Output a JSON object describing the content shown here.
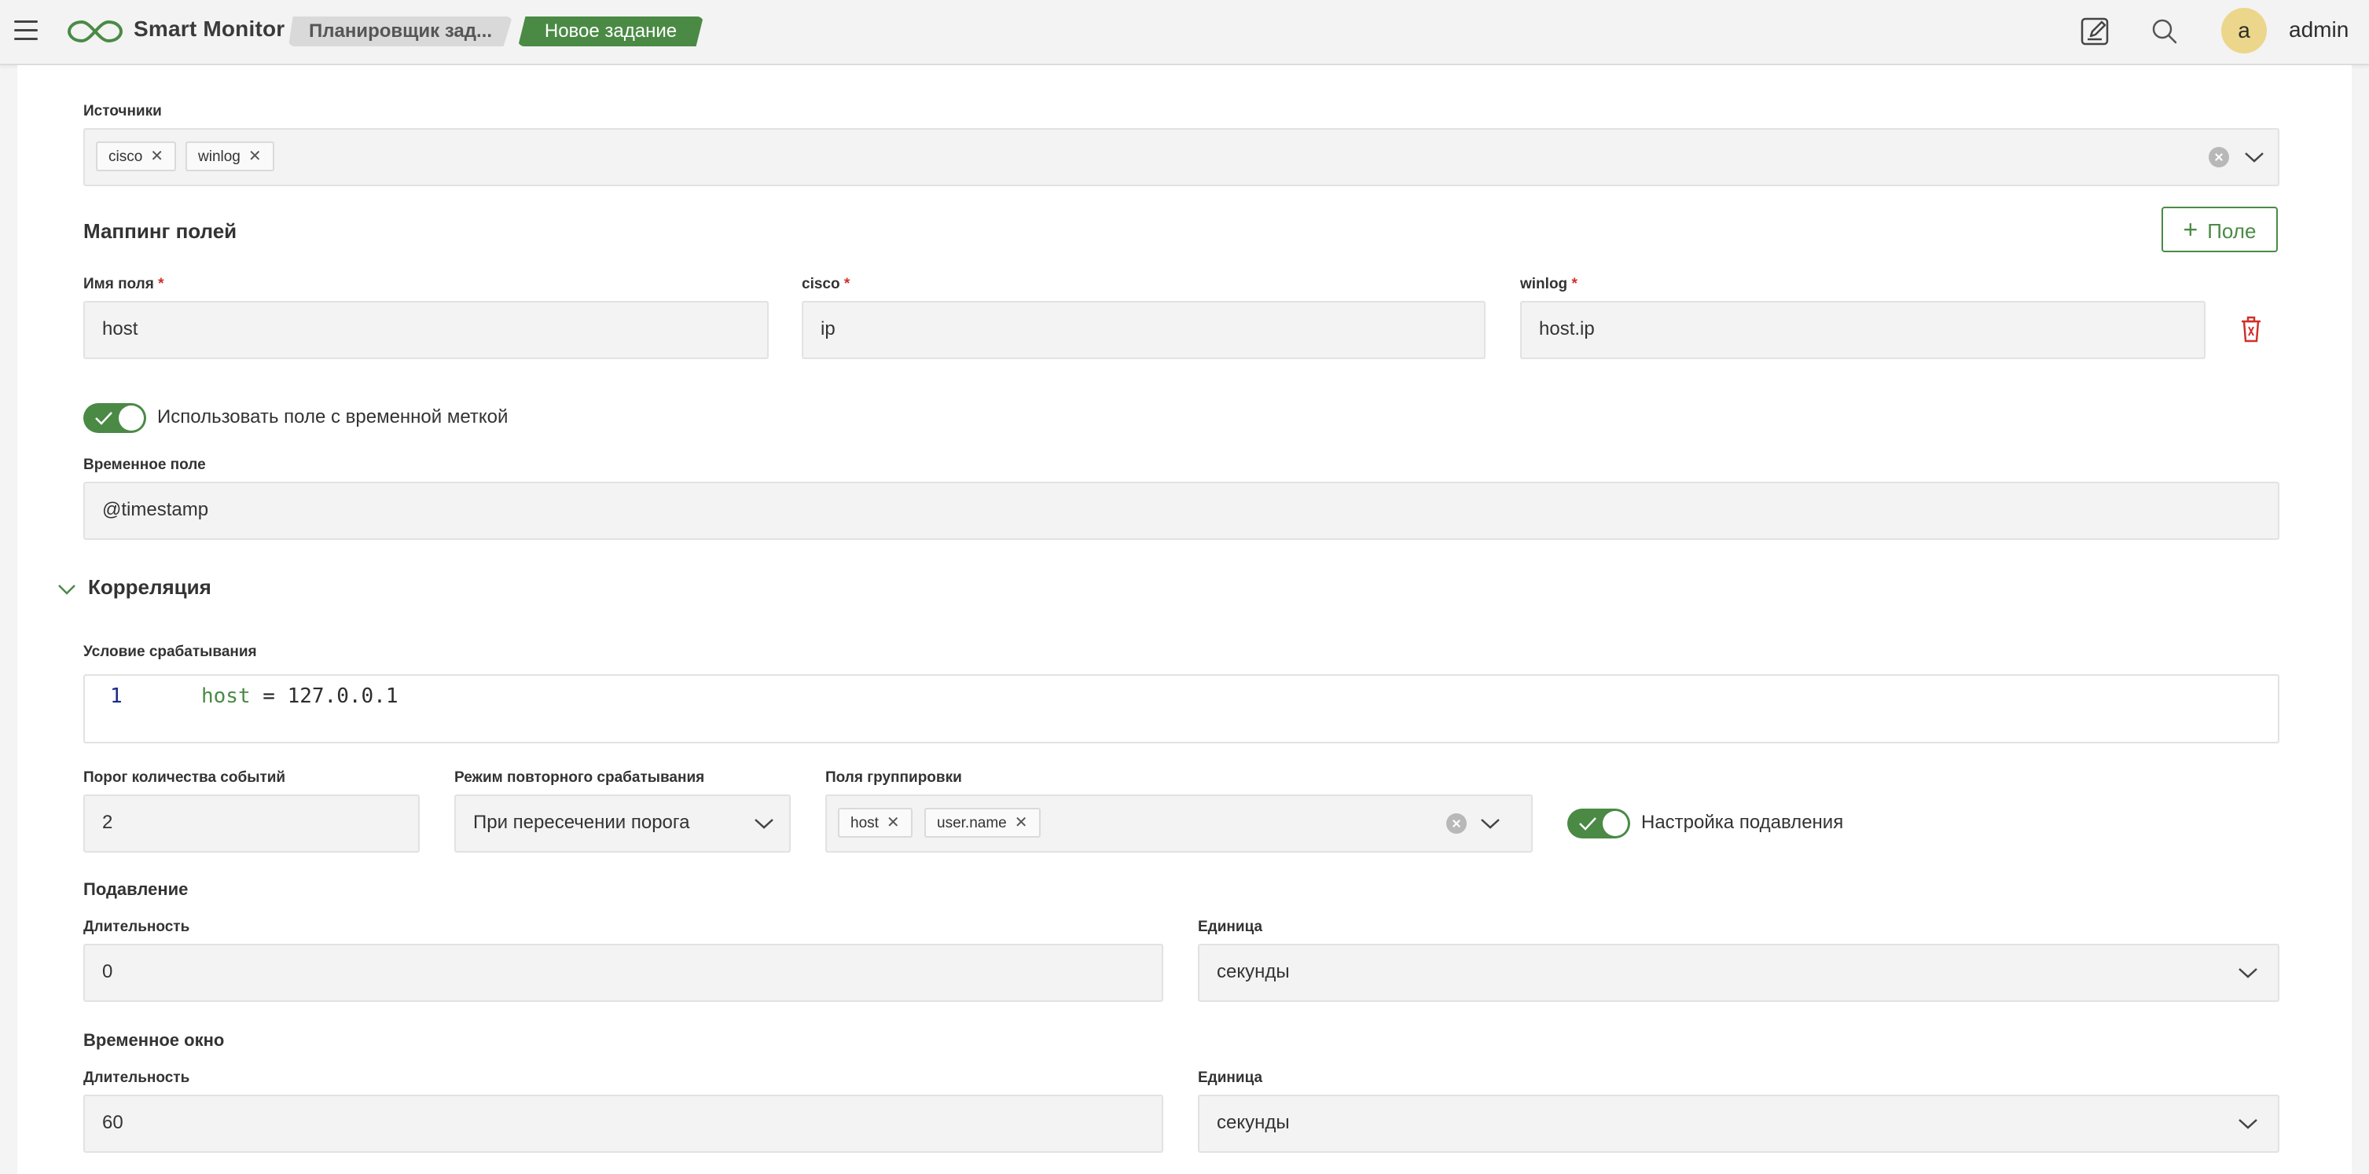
{
  "header": {
    "app_name": "Smart Monitor",
    "breadcrumbs": [
      {
        "label": "Планировщик зад..."
      },
      {
        "label": "Новое задание"
      }
    ],
    "avatar_letter": "a",
    "user_name": "admin",
    "icons": [
      "menu-icon",
      "logo-icon",
      "edit-icon",
      "search-icon"
    ],
    "colors": {
      "accent": "#4a8a45",
      "avatar": "#ecd68b",
      "danger": "#d0302b"
    }
  },
  "sources": {
    "label": "Источники",
    "chips": [
      "cisco",
      "winlog"
    ]
  },
  "mapping": {
    "title": "Маппинг полей",
    "add_button": "Поле",
    "columns": [
      {
        "label": "Имя поля",
        "value": "host"
      },
      {
        "label": "cisco",
        "value": "ip"
      },
      {
        "label": "winlog",
        "value": "host.ip"
      }
    ],
    "required_mark": "*"
  },
  "timestamp": {
    "toggle_label": "Использовать поле с временной меткой",
    "toggle_on": true,
    "field_label": "Временное поле",
    "field_value": "@timestamp"
  },
  "correlation": {
    "title": "Корреляция",
    "condition_label": "Условие срабатывания",
    "code_line_number": "1",
    "code_keyword": "host",
    "code_operator": " = ",
    "code_value": "127.0.0.1",
    "threshold_label": "Порог количества событий",
    "threshold_value": "2",
    "retrigger_label": "Режим повторного срабатывания",
    "retrigger_value": "При пересечении порога",
    "grouping_label": "Поля группировки",
    "grouping_chips": [
      "host",
      "user.name"
    ],
    "suppression_toggle_label": "Настройка подавления",
    "suppression_toggle_on": true
  },
  "suppression": {
    "title": "Подавление",
    "duration_label": "Длительность",
    "duration_value": "0",
    "unit_label": "Единица",
    "unit_value": "секунды"
  },
  "time_window": {
    "title": "Временное окно",
    "duration_label": "Длительность",
    "duration_value": "60",
    "unit_label": "Единица",
    "unit_value": "секунды"
  }
}
